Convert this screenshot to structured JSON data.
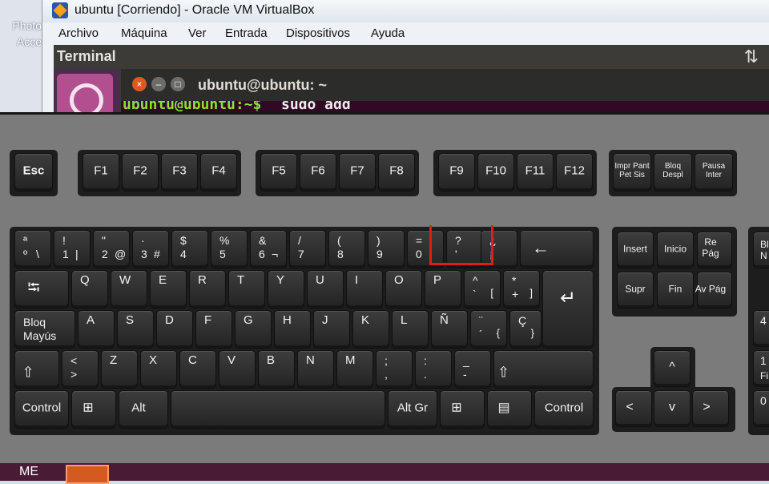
{
  "desktop": {
    "icon_label_line1": "Photo",
    "icon_label_line2": "Acce",
    "taskbar_label": "ME"
  },
  "window": {
    "title": "ubuntu [Corriendo] - Oracle VM VirtualBox",
    "menu": [
      "Archivo",
      "Máquina",
      "Ver",
      "Entrada",
      "Dispositivos",
      "Ayuda"
    ]
  },
  "guest": {
    "panel_title": "Terminal",
    "terminal_title": "ubuntu@ubuntu: ~",
    "prompt": "ubuntu@ubuntu:~$",
    "command": "sudo add"
  },
  "keyboard": {
    "function_row": {
      "esc": "Esc",
      "f_keys": [
        "F1",
        "F2",
        "F3",
        "F4",
        "F5",
        "F6",
        "F7",
        "F8",
        "F9",
        "F10",
        "F11",
        "F12"
      ],
      "sys_keys": [
        "Impr Pant Pet Sis",
        "Bloq Despl",
        "Pausa Inter"
      ]
    },
    "number_row": [
      {
        "top": "ª",
        "bottom": "º",
        "alt": "\\"
      },
      {
        "top": "!",
        "bottom": "1",
        "alt": "|"
      },
      {
        "top": "\"",
        "bottom": "2",
        "alt": "@"
      },
      {
        "top": "·",
        "bottom": "3",
        "alt": "#"
      },
      {
        "top": "$",
        "bottom": "4",
        "alt": ""
      },
      {
        "top": "%",
        "bottom": "5",
        "alt": ""
      },
      {
        "top": "&",
        "bottom": "6",
        "alt": "¬"
      },
      {
        "top": "/",
        "bottom": "7",
        "alt": ""
      },
      {
        "top": "(",
        "bottom": "8",
        "alt": ""
      },
      {
        "top": ")",
        "bottom": "9",
        "alt": ""
      },
      {
        "top": "=",
        "bottom": "0",
        "alt": ""
      },
      {
        "top": "?",
        "bottom": "'",
        "alt": ""
      },
      {
        "top": "¿",
        "bottom": "¡",
        "alt": ""
      }
    ],
    "backspace": "←",
    "tab_row": [
      "Q",
      "W",
      "E",
      "R",
      "T",
      "Y",
      "U",
      "I",
      "O",
      "P"
    ],
    "tab_extra": [
      {
        "top": "^",
        "bottom": "`",
        "alt": "["
      },
      {
        "top": "*",
        "bottom": "+",
        "alt": "]"
      }
    ],
    "tab": "⭾",
    "enter": "↵",
    "caps": "Bloq Mayús",
    "home_row": [
      "A",
      "S",
      "D",
      "F",
      "G",
      "H",
      "J",
      "K",
      "L",
      "Ñ"
    ],
    "home_extra": [
      {
        "top": "¨",
        "bottom": "´",
        "alt": "{"
      },
      {
        "top": "Ç",
        "bottom": "",
        "alt": "}"
      }
    ],
    "shift": "⇧",
    "shift_row": [
      "Z",
      "X",
      "C",
      "V",
      "B",
      "N",
      "M"
    ],
    "angle": {
      "top": "<",
      "bottom": ">"
    },
    "shift_extra": [
      {
        "top": ";",
        "bottom": ","
      },
      {
        "top": ":",
        "bottom": "."
      },
      {
        "top": "_",
        "bottom": "-"
      }
    ],
    "bottom_row": {
      "control": "Control",
      "alt": "Alt",
      "altgr": "Alt Gr",
      "space": ""
    },
    "nav": [
      "Insert",
      "Inicio",
      "Re Pág",
      "Supr",
      "Fin",
      "Av Pág"
    ],
    "arrows": {
      "up": "^",
      "left": "<",
      "down": "v",
      "right": ">"
    },
    "numpad_fragments": [
      "Bl",
      "N",
      "4",
      "1",
      "Fi",
      "0"
    ]
  }
}
